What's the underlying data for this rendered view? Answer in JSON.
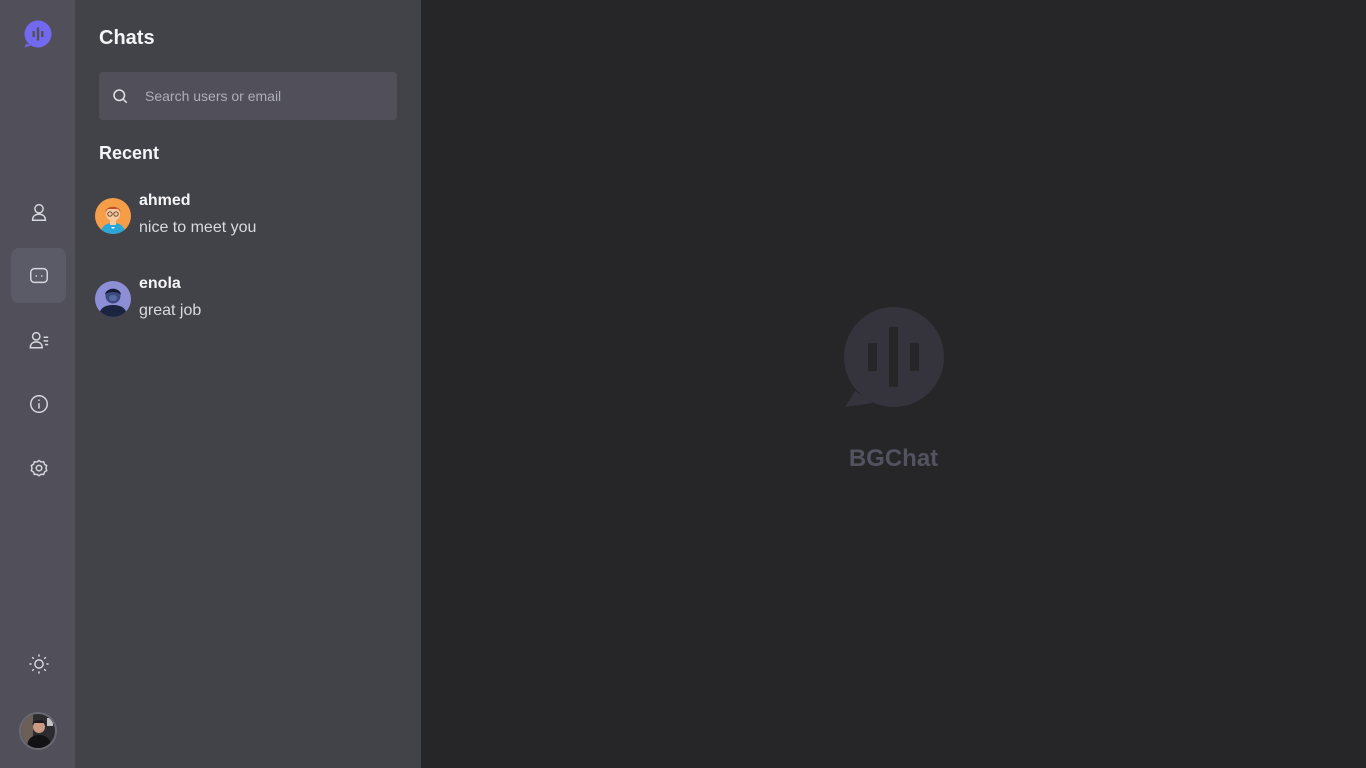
{
  "colors": {
    "accent": "#7269ef",
    "rail_bg": "#51505a",
    "panel_bg": "#424249",
    "main_bg": "#262629",
    "brand_text": "#53535f"
  },
  "rail": {
    "logo_icon": "chat-bubble-logo-icon",
    "items": [
      {
        "icon": "profile-icon",
        "active": false
      },
      {
        "icon": "chats-icon",
        "active": true
      },
      {
        "icon": "contacts-icon",
        "active": false
      },
      {
        "icon": "info-icon",
        "active": false
      },
      {
        "icon": "settings-icon",
        "active": false
      }
    ],
    "theme_icon": "sun-icon",
    "user_avatar_icon": "user-avatar"
  },
  "panel": {
    "title": "Chats",
    "search": {
      "placeholder": "Search users or email",
      "value": ""
    },
    "recent_title": "Recent",
    "chats": [
      {
        "name": "ahmed",
        "last_message": "nice to meet you"
      },
      {
        "name": "enola",
        "last_message": "great job"
      }
    ]
  },
  "main": {
    "brand_name": "BGChat"
  }
}
